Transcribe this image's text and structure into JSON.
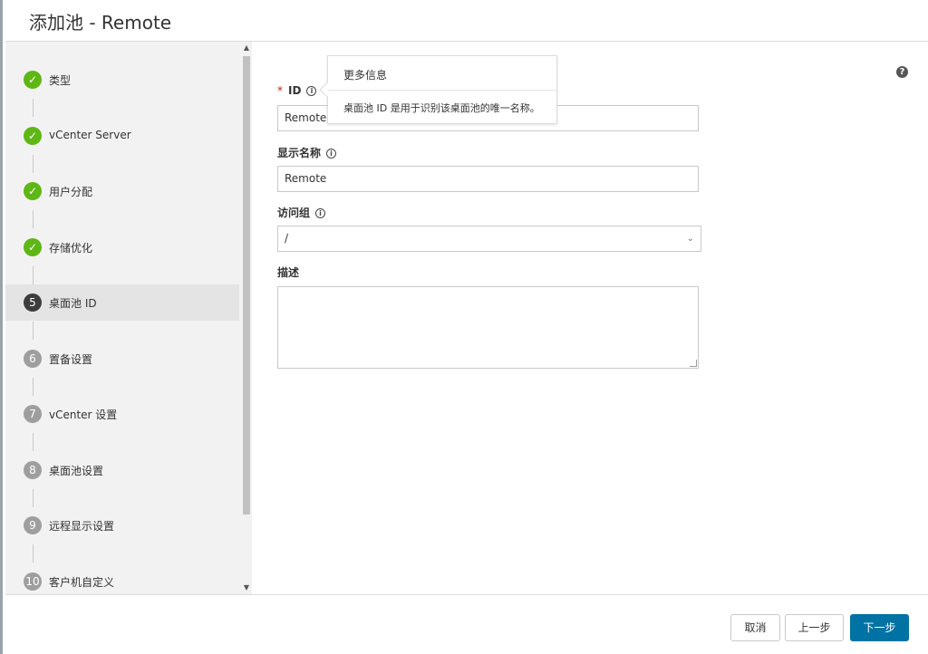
{
  "header": {
    "title": "添加池 - Remote"
  },
  "sidebar": {
    "steps": [
      {
        "num": "✓",
        "label": "类型",
        "state": "done"
      },
      {
        "num": "✓",
        "label": "vCenter Server",
        "state": "done"
      },
      {
        "num": "✓",
        "label": "用户分配",
        "state": "done"
      },
      {
        "num": "✓",
        "label": "存储优化",
        "state": "done"
      },
      {
        "num": "5",
        "label": "桌面池 ID",
        "state": "current"
      },
      {
        "num": "6",
        "label": "置备设置",
        "state": "todo"
      },
      {
        "num": "7",
        "label": "vCenter 设置",
        "state": "todo"
      },
      {
        "num": "8",
        "label": "桌面池设置",
        "state": "todo"
      },
      {
        "num": "9",
        "label": "远程显示设置",
        "state": "todo"
      },
      {
        "num": "10",
        "label": "客户机自定义",
        "state": "todo"
      }
    ]
  },
  "form": {
    "id_required": "*",
    "id_label": "ID",
    "id_value": "Remote",
    "display_name_label": "显示名称",
    "display_name_value": "Remote",
    "access_group_label": "访问组",
    "access_group_value": "/",
    "description_label": "描述",
    "description_value": ""
  },
  "popover": {
    "title": "更多信息",
    "body": "桌面池 ID 是用于识别该桌面池的唯一名称。"
  },
  "footer": {
    "cancel_label": "取消",
    "back_label": "上一步",
    "next_label": "下一步"
  },
  "colors": {
    "done": "#5eb715",
    "current": "#3c3c3c",
    "todo": "#9e9e9e",
    "primary": "#0072a3"
  },
  "icons": {
    "help": "?",
    "info": "i",
    "check": "✓",
    "chevron": "⌄"
  }
}
